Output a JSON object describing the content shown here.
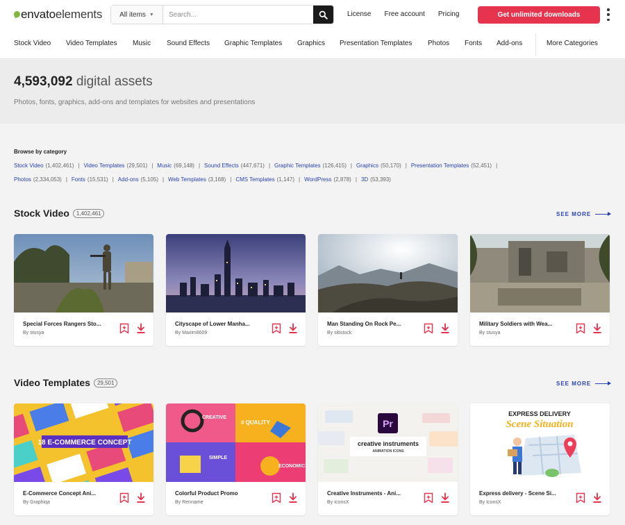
{
  "header": {
    "logo": {
      "part1": "envato",
      "part2": "elements"
    },
    "search": {
      "scope_label": "All items",
      "placeholder": "Search..."
    },
    "links": [
      "License",
      "Free account",
      "Pricing"
    ],
    "cta_label": "Get unlimited downloads"
  },
  "nav": {
    "categories": [
      "Stock Video",
      "Video Templates",
      "Music",
      "Sound Effects",
      "Graphic Templates",
      "Graphics",
      "Presentation Templates",
      "Photos",
      "Fonts",
      "Add-ons"
    ],
    "more_label": "More Categories"
  },
  "hero": {
    "count": "4,593,092",
    "count_suffix": "digital assets",
    "subtitle": "Photos, fonts, graphics, add-ons and templates for websites and presentations"
  },
  "browse": {
    "heading": "Browse by category",
    "row1": [
      {
        "name": "Stock Video",
        "count": "(1,402,461)"
      },
      {
        "name": "Video Templates",
        "count": "(29,501)"
      },
      {
        "name": "Music",
        "count": "(69,148)"
      },
      {
        "name": "Sound Effects",
        "count": "(447,671)"
      },
      {
        "name": "Graphic Templates",
        "count": "(126,415)"
      },
      {
        "name": "Graphics",
        "count": "(50,170)"
      },
      {
        "name": "Presentation Templates",
        "count": "(52,451)"
      }
    ],
    "row2": [
      {
        "name": "Photos",
        "count": "(2,334,053)"
      },
      {
        "name": "Fonts",
        "count": "(15,531)"
      },
      {
        "name": "Add-ons",
        "count": "(5,105)"
      },
      {
        "name": "Web Templates",
        "count": "(3,168)"
      },
      {
        "name": "CMS Templates",
        "count": "(1,147)"
      },
      {
        "name": "WordPress",
        "count": "(2,878)"
      },
      {
        "name": "3D",
        "count": "(53,393)"
      }
    ]
  },
  "sections": [
    {
      "title": "Stock Video",
      "count": "1,402,461",
      "see_more": "SEE MORE",
      "items": [
        {
          "title": "Special Forces Rangers Sto...",
          "author": "By stusya"
        },
        {
          "title": "Cityscape of Lower Manha...",
          "author": "By Maxim8609"
        },
        {
          "title": "Man Standing On Rock Pe...",
          "author": "By sibstock"
        },
        {
          "title": "Military Soldiers with Wea...",
          "author": "By stusya"
        }
      ]
    },
    {
      "title": "Video Templates",
      "count": "29,501",
      "see_more": "SEE MORE",
      "items": [
        {
          "title": "E-Commerce Concept Ani...",
          "author": "By Graphiqa"
        },
        {
          "title": "Colorful Product Promo",
          "author": "By Renname"
        },
        {
          "title": "Creative Instruments - Ani...",
          "author": "By IconsX"
        },
        {
          "title": "Express delivery - Scene Si...",
          "author": "By IconsX"
        }
      ]
    }
  ],
  "thumb_text": {
    "ecommerce": "18 E-COMMERCE CONCEPT",
    "promo_creative": "CREATIVE",
    "promo_quality": "# QUALITY",
    "promo_simple": "SIMPLE",
    "promo_economic": "ECONOMIC",
    "ci_logo": "Pr",
    "ci_title": "creative instruments",
    "ci_sub": "ANIMATION ICONS",
    "ed_title": "EXPRESS DELIVERY",
    "ed_sub": "Scene Situation"
  },
  "colors": {
    "accent": "#e6344e",
    "link": "#2a43b2",
    "brand_green": "#82b541"
  }
}
